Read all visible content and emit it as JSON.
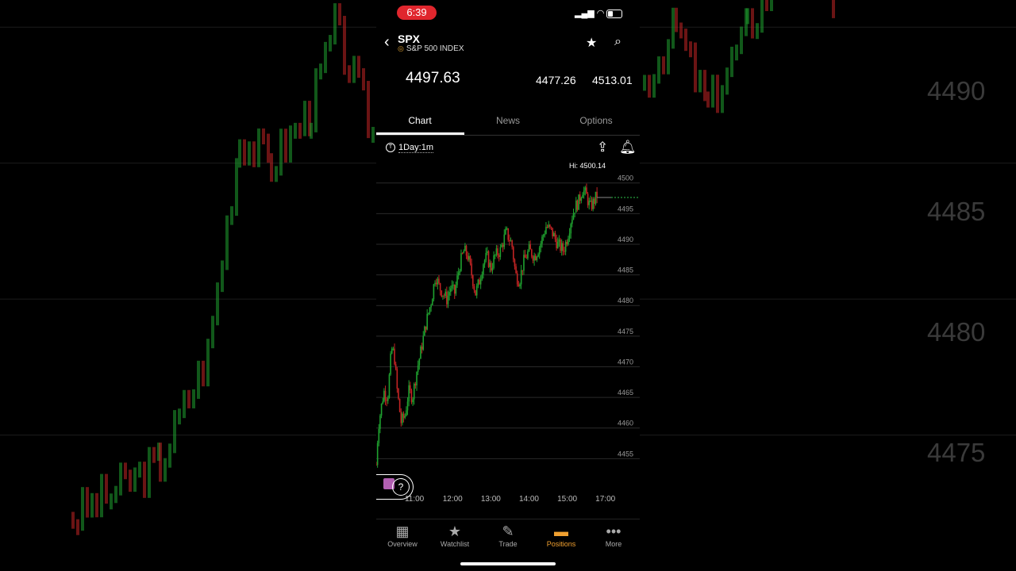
{
  "status": {
    "time": "6:39"
  },
  "header": {
    "symbol": "SPX",
    "name": "S&P 500 INDEX"
  },
  "quote": {
    "last": "4497.63",
    "low": "4477.26",
    "high": "4513.01"
  },
  "tabs": [
    {
      "label": "Chart",
      "active": true
    },
    {
      "label": "News"
    },
    {
      "label": "Options"
    }
  ],
  "toolbar": {
    "timeframe": "1Day:1m"
  },
  "chart_data": {
    "type": "candlestick",
    "hi_label": "Hi: 4500.14",
    "y_ticks": [
      4500,
      4495,
      4490,
      4485,
      4480,
      4475,
      4470,
      4465,
      4460,
      4455
    ],
    "ylim": [
      4450,
      4501
    ],
    "x_ticks": [
      "11:00",
      "12:00",
      "13:00",
      "14:00",
      "15:00",
      "17:00"
    ],
    "x_tick_hours": [
      11,
      12,
      13,
      14,
      15,
      16
    ],
    "xlim": [
      10.0,
      16.9
    ],
    "current_price": 4497.63,
    "path": [
      [
        10.0,
        4454
      ],
      [
        10.05,
        4460
      ],
      [
        10.12,
        4463
      ],
      [
        10.2,
        4466
      ],
      [
        10.3,
        4465
      ],
      [
        10.4,
        4473
      ],
      [
        10.47,
        4472
      ],
      [
        10.55,
        4466
      ],
      [
        10.65,
        4461
      ],
      [
        10.75,
        4462
      ],
      [
        10.85,
        4466
      ],
      [
        10.95,
        4465
      ],
      [
        11.05,
        4469
      ],
      [
        11.15,
        4472
      ],
      [
        11.3,
        4477
      ],
      [
        11.45,
        4481
      ],
      [
        11.55,
        4485
      ],
      [
        11.65,
        4483
      ],
      [
        11.75,
        4482
      ],
      [
        11.85,
        4481
      ],
      [
        11.95,
        4483
      ],
      [
        12.05,
        4482
      ],
      [
        12.2,
        4487
      ],
      [
        12.3,
        4489
      ],
      [
        12.4,
        4488
      ],
      [
        12.5,
        4485
      ],
      [
        12.6,
        4482
      ],
      [
        12.7,
        4484
      ],
      [
        12.8,
        4487
      ],
      [
        12.9,
        4488
      ],
      [
        13.0,
        4486
      ],
      [
        13.1,
        4488
      ],
      [
        13.25,
        4489
      ],
      [
        13.4,
        4492
      ],
      [
        13.55,
        4490
      ],
      [
        13.65,
        4485
      ],
      [
        13.75,
        4484
      ],
      [
        13.85,
        4487
      ],
      [
        14.0,
        4489
      ],
      [
        14.15,
        4488
      ],
      [
        14.3,
        4490
      ],
      [
        14.45,
        4493
      ],
      [
        14.6,
        4492
      ],
      [
        14.75,
        4490
      ],
      [
        14.9,
        4489
      ],
      [
        15.0,
        4491
      ],
      [
        15.1,
        4494
      ],
      [
        15.2,
        4496
      ],
      [
        15.3,
        4497
      ],
      [
        15.4,
        4499
      ],
      [
        15.5,
        4498
      ],
      [
        15.6,
        4496
      ],
      [
        15.7,
        4497
      ],
      [
        15.78,
        4498
      ]
    ]
  },
  "nav": [
    {
      "label": "Overview",
      "icon": "overview-icon"
    },
    {
      "label": "Watchlist",
      "icon": "watchlist-icon"
    },
    {
      "label": "Trade",
      "icon": "trade-icon"
    },
    {
      "label": "Positions",
      "icon": "positions-icon",
      "active": true
    },
    {
      "label": "More",
      "icon": "more-icon"
    }
  ],
  "background": {
    "price_labels": [
      "4490",
      "4485",
      "4480",
      "4475"
    ],
    "price_levels": [
      4490,
      4485,
      4480,
      4475
    ],
    "range": [
      4470,
      4491
    ]
  },
  "colors": {
    "up": "#1fa12f",
    "down": "#c22424",
    "accent": "#f0a030",
    "price_line": "#2ec44a"
  }
}
